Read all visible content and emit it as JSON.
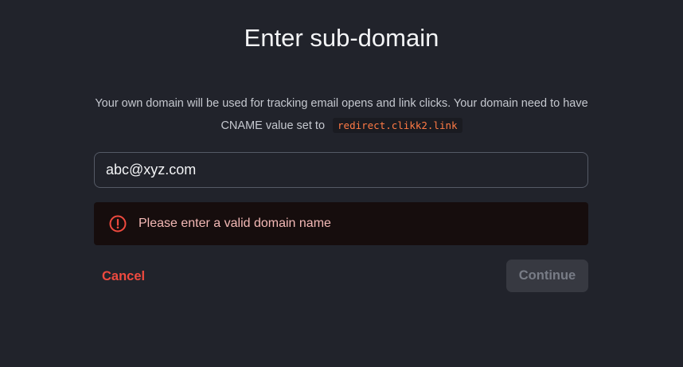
{
  "dialog": {
    "title": "Enter sub-domain",
    "description_line1": "Your own domain will be used for tracking email opens and link clicks. Your domain need to have",
    "description_line2": "CNAME value set to",
    "cname_value": "redirect.clikk2.link"
  },
  "domain_input": {
    "value": "abc@xyz.com"
  },
  "error": {
    "message": "Please enter a valid domain name",
    "icon": "error-circle-icon",
    "color": "#ef4a3f"
  },
  "actions": {
    "cancel_label": "Cancel",
    "continue_label": "Continue"
  },
  "colors": {
    "background": "#21232b",
    "accent_red": "#ef4a3f",
    "code_orange": "#ff7a45"
  }
}
